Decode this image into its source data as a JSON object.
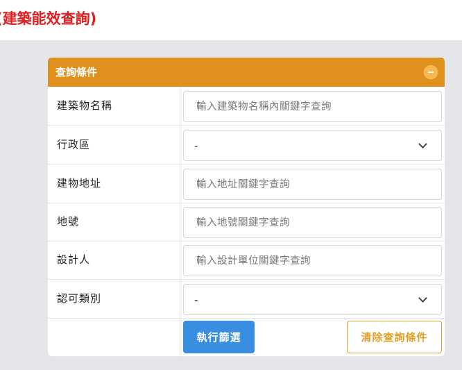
{
  "page": {
    "title": "(建築能效查詢)"
  },
  "panel": {
    "title": "查詢條件",
    "collapse_icon": "minus-circle-icon"
  },
  "form": {
    "building_name": {
      "label": "建築物名稱",
      "placeholder": "輸入建築物名稱內關鍵字查詢",
      "value": ""
    },
    "district": {
      "label": "行政區",
      "selected": "-"
    },
    "address": {
      "label": "建物地址",
      "placeholder": "輸入地址關鍵字查詢",
      "value": ""
    },
    "land_number": {
      "label": "地號",
      "placeholder": "輸入地號關鍵字查詢",
      "value": ""
    },
    "designer": {
      "label": "設計人",
      "placeholder": "輸入設計單位關鍵字查詢",
      "value": ""
    },
    "approval_type": {
      "label": "認可類別",
      "selected": "-"
    }
  },
  "actions": {
    "filter_label": "執行篩選",
    "clear_label": "清除查詢條件"
  },
  "colors": {
    "title_red": "#e01e1e",
    "panel_header": "#e0901c",
    "primary_button": "#3a8ee2",
    "outline_button": "#e0a028",
    "background": "#e4e6ea"
  }
}
